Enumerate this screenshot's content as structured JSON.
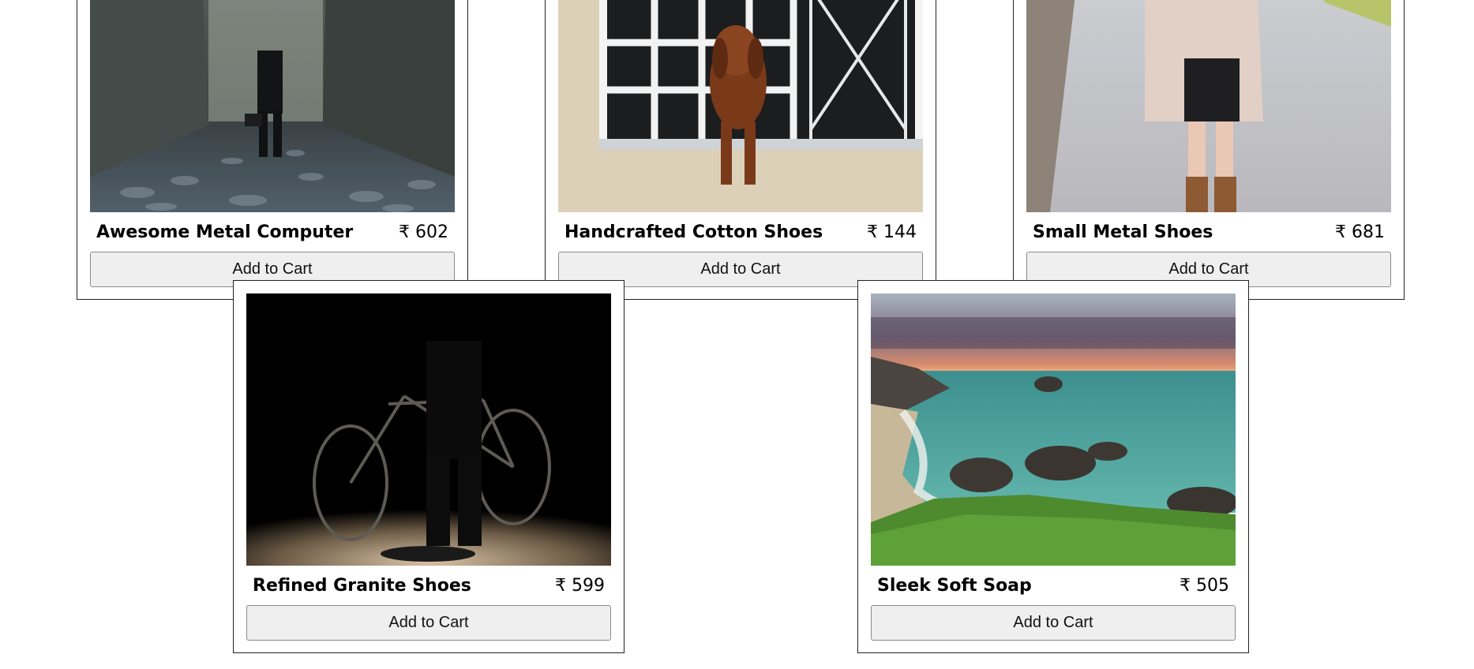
{
  "products": [
    {
      "name": "Awesome Metal Computer",
      "price": "₹ 602",
      "button": "Add to Cart",
      "image": "man-in-corridor-photo"
    },
    {
      "name": "Handcrafted Cotton Shoes",
      "price": "₹ 144",
      "button": "Add to Cart",
      "image": "dachshund-window-photo"
    },
    {
      "name": "Small Metal Shoes",
      "price": "₹ 681",
      "button": "Add to Cart",
      "image": "woman-walking-road-photo"
    },
    {
      "name": "Refined Granite Shoes",
      "price": "₹ 599",
      "button": "Add to Cart",
      "image": "bicycle-silhouette-photo"
    },
    {
      "name": "Sleek Soft Soap",
      "price": "₹ 505",
      "button": "Add to Cart",
      "image": "coastal-sunset-photo"
    }
  ]
}
